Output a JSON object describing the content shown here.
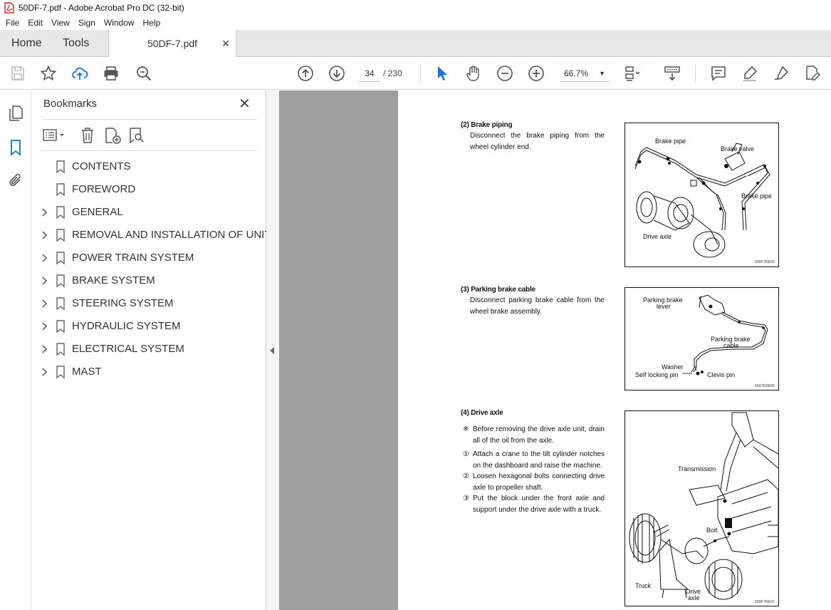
{
  "app": {
    "title": "50DF-7.pdf - Adobe Acrobat Pro DC (32-bit)",
    "menu": [
      "File",
      "Edit",
      "View",
      "Sign",
      "Window",
      "Help"
    ],
    "tabs": {
      "home": "Home",
      "tools": "Tools",
      "doc": "50DF-7.pdf"
    }
  },
  "toolbar": {
    "page_current": "34",
    "page_total": "/ 230",
    "zoom": "66.7%"
  },
  "bookmarks": {
    "title": "Bookmarks",
    "items": [
      {
        "label": "CONTENTS",
        "expandable": false
      },
      {
        "label": "FOREWORD",
        "expandable": false
      },
      {
        "label": "GENERAL",
        "expandable": true
      },
      {
        "label": "REMOVAL AND INSTALLATION OF UNIT",
        "expandable": true
      },
      {
        "label": "POWER TRAIN SYSTEM",
        "expandable": true
      },
      {
        "label": "BRAKE SYSTEM",
        "expandable": true
      },
      {
        "label": "STEERING SYSTEM",
        "expandable": true
      },
      {
        "label": "HYDRAULIC SYSTEM",
        "expandable": true
      },
      {
        "label": "ELECTRICAL SYSTEM",
        "expandable": true
      },
      {
        "label": "MAST",
        "expandable": true
      }
    ]
  },
  "document": {
    "s2": {
      "heading": "(2) Brake piping",
      "text": "Disconnect the brake piping from the wheel cylinder end.",
      "fig": {
        "labels": [
          "Brake pipe",
          "Brake valve",
          "Brake pipe",
          "Drive axle"
        ],
        "code": "50DF7RE05"
      }
    },
    "s3": {
      "heading": "(3) Parking brake cable",
      "text": "Disconnect parking brake cable from the wheel brake assembly.",
      "fig": {
        "labels": [
          "Parking brake",
          "lever",
          "Parking brake",
          "cable",
          "Washer",
          "Self locking pin",
          "Clevis pin"
        ],
        "code": "50D7ERE06"
      }
    },
    "s4": {
      "heading": "(4) Drive axle",
      "steps": [
        {
          "mark": "※",
          "text": "Before removing the drive axle unit, drain all of the oil from the axle."
        },
        {
          "mark": "①",
          "text": "Attach a crane to the tilt cylinder notches on the dashboard and raise the machine."
        },
        {
          "mark": "②",
          "text": "Loosen hexagonal bolts connecting drive axle to propeller shaft."
        },
        {
          "mark": "③",
          "text": "Put the block under the front axle and support under the drive axle with a truck."
        }
      ],
      "fig": {
        "labels": [
          "Transmission",
          "Bolt",
          "Truck",
          "Drive",
          "axle"
        ],
        "code": "50DF7RE07"
      }
    }
  }
}
